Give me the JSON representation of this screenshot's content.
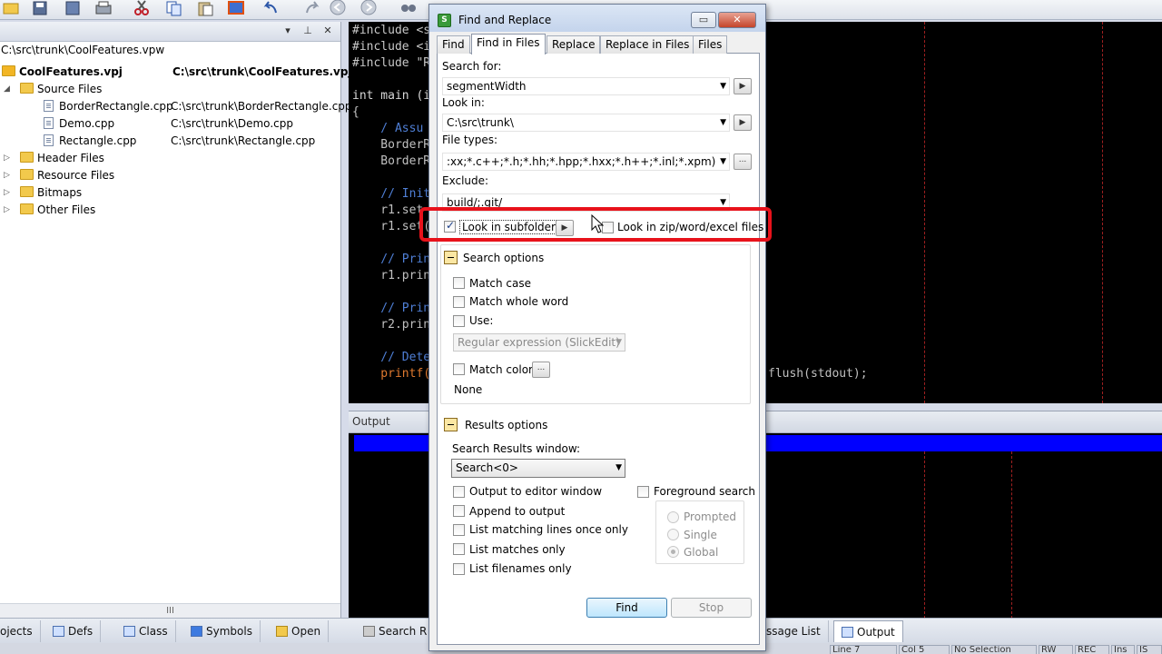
{
  "colors": {
    "editor_bg": "#000000",
    "output_highlight": "#0000ff",
    "annotation_red": "#e8121b"
  },
  "project_panel": {
    "workspace_path": "C:\\src\\trunk\\CoolFeatures.vpw",
    "tree": [
      {
        "label": "CoolFeatures.vpj",
        "path": "C:\\src\\trunk\\CoolFeatures.vpj",
        "bold": true
      },
      {
        "label": "Source Files"
      },
      {
        "label": "BorderRectangle.cpp",
        "path": "C:\\src\\trunk\\BorderRectangle.cpp"
      },
      {
        "label": "Demo.cpp",
        "path": "C:\\src\\trunk\\Demo.cpp"
      },
      {
        "label": "Rectangle.cpp",
        "path": "C:\\src\\trunk\\Rectangle.cpp"
      },
      {
        "label": "Header Files"
      },
      {
        "label": "Resource Files"
      },
      {
        "label": "Bitmaps"
      },
      {
        "label": "Other Files"
      }
    ],
    "scroll_mark": "III"
  },
  "editor": {
    "lines": [
      {
        "text": "#include <s"
      },
      {
        "text": "#include <i"
      },
      {
        "text": "#include \"R"
      },
      {
        "text": "int main (i"
      },
      {
        "text": "{"
      },
      {
        "text": "    / Assu"
      },
      {
        "text": "    BorderR"
      },
      {
        "text": "    BorderR"
      },
      {
        "text": "    // Init"
      },
      {
        "text": "    r1.set"
      },
      {
        "text": "    r1.set("
      },
      {
        "text": "    // Prin"
      },
      {
        "text": "    r1.prin"
      },
      {
        "text": "    // Prin"
      },
      {
        "text": "    r2.prin"
      },
      {
        "text": "    // Dete"
      },
      {
        "text": "    printf("
      }
    ],
    "tail_text": "flush(stdout);"
  },
  "output_panel": {
    "title": "Output"
  },
  "bottom_tabs": [
    "ojects",
    "Defs",
    "Class",
    "Symbols",
    "Open",
    "Search R",
    "ssage List",
    "Output"
  ],
  "status_bar": [
    "Line 7",
    "Col 5",
    "No Selection",
    "RW",
    "REC",
    "Ins",
    "IS"
  ],
  "dialog": {
    "title": "Find and Replace",
    "tabs": [
      "Find",
      "Find in Files",
      "Replace",
      "Replace in Files",
      "Files"
    ],
    "active_tab": "Find in Files",
    "search_for": {
      "label": "Search for:",
      "value": "segmentWidth"
    },
    "look_in": {
      "label": "Look in:",
      "value": "C:\\src\\trunk\\"
    },
    "file_types": {
      "label": "File types:",
      "value": ":xx;*.c++;*.h;*.hh;*.hpp;*.hxx;*.h++;*.inl;*.xpm)"
    },
    "exclude": {
      "label": "Exclude:",
      "value": "build/;.git/"
    },
    "look_in_subfolders": {
      "label": "Look in subfolders",
      "checked": true
    },
    "look_in_zip": {
      "label": "Look in zip/word/excel files",
      "checked": false
    },
    "search_options": {
      "label": "Search options",
      "match_case": "Match case",
      "match_whole_word": "Match whole word",
      "use": "Use:",
      "regex_type": "Regular expression (SlickEdit)",
      "match_color": "Match color",
      "color_value": "None"
    },
    "results_options": {
      "label": "Results options",
      "results_window_label": "Search Results window:",
      "results_window_value": "Search<0>",
      "output_to_editor": "Output to editor window",
      "append_to_output": "Append to output",
      "list_matching_lines_once": "List matching lines once only",
      "list_matches_only": "List matches only",
      "list_filenames_only": "List filenames only",
      "foreground_search": "Foreground search",
      "radio_prompted": "Prompted",
      "radio_single": "Single",
      "radio_global": "Global"
    },
    "find_button": "Find",
    "stop_button": "Stop",
    "ellipsis": "...",
    "min_glyph": "▭",
    "close_glyph": "✕"
  }
}
